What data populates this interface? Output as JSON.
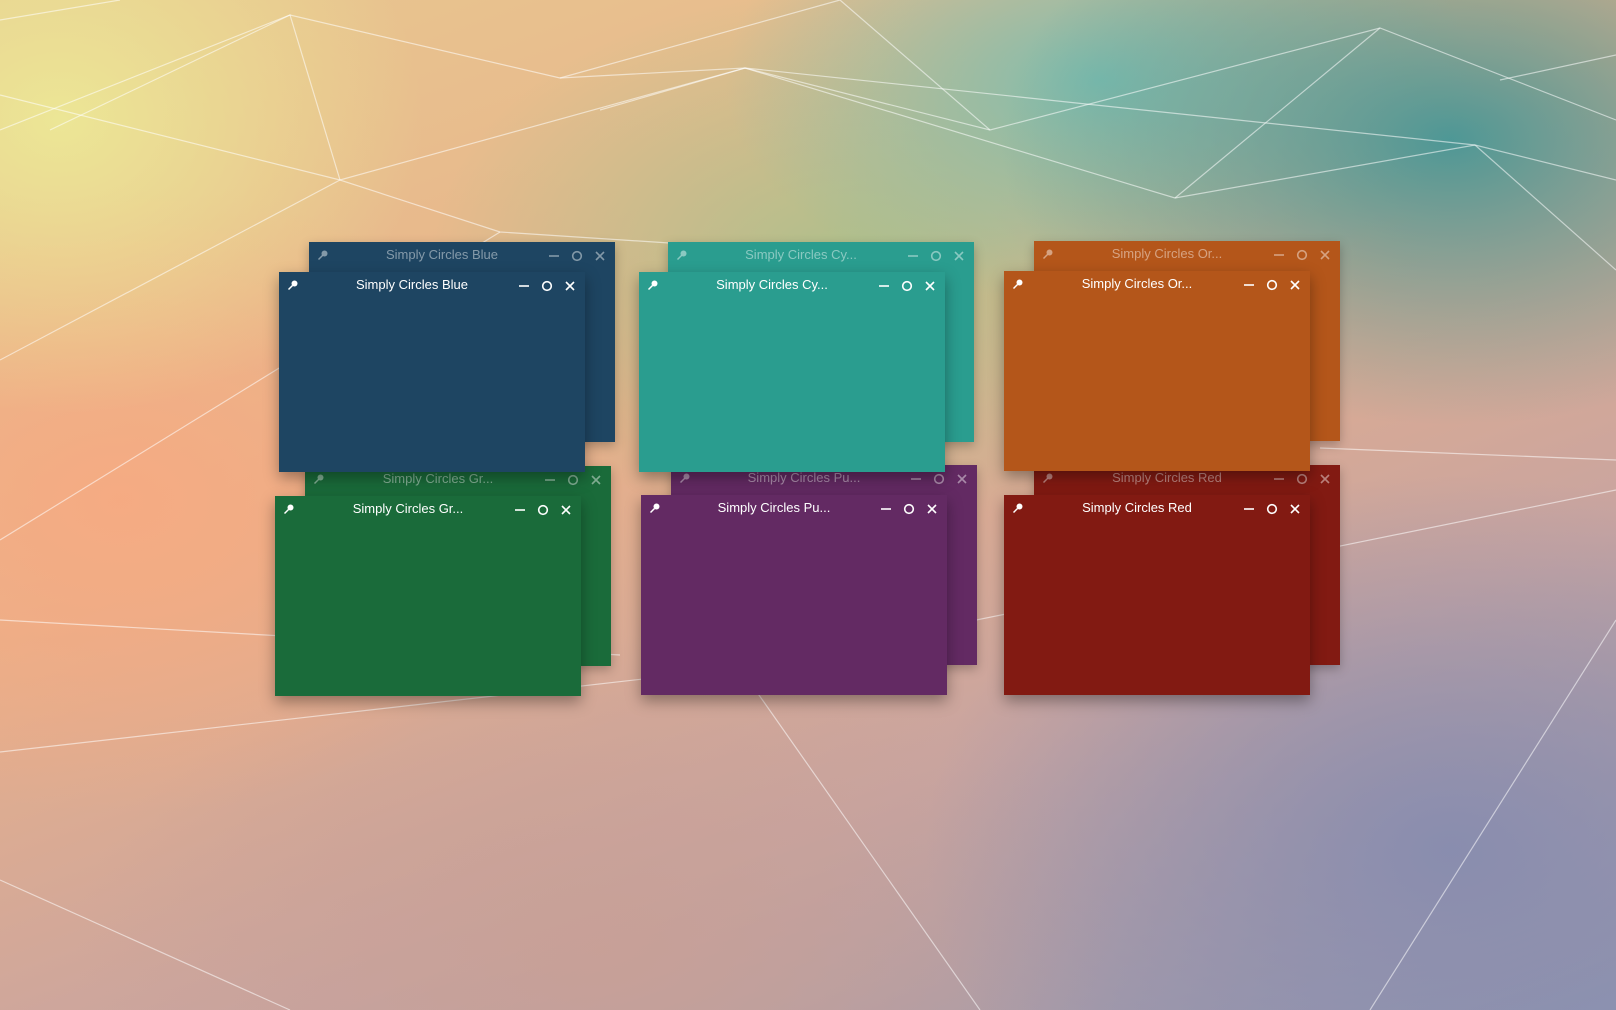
{
  "windows": [
    {
      "id": "blue",
      "title": "Simply Circles Blue",
      "color": "#1e4562"
    },
    {
      "id": "cyan",
      "title": "Simply Circles Cy...",
      "color": "#2a9d8f"
    },
    {
      "id": "orange",
      "title": "Simply Circles Or...",
      "color": "#b4561a"
    },
    {
      "id": "green",
      "title": "Simply Circles Gr...",
      "color": "#1a6b3a"
    },
    {
      "id": "purple",
      "title": "Simply Circles Pu...",
      "color": "#632a63"
    },
    {
      "id": "red",
      "title": "Simply Circles Red",
      "color": "#821a12"
    }
  ],
  "icons": {
    "pin": "pin-icon",
    "minimize": "minimize-icon",
    "maximize": "maximize-icon",
    "close": "close-icon"
  }
}
